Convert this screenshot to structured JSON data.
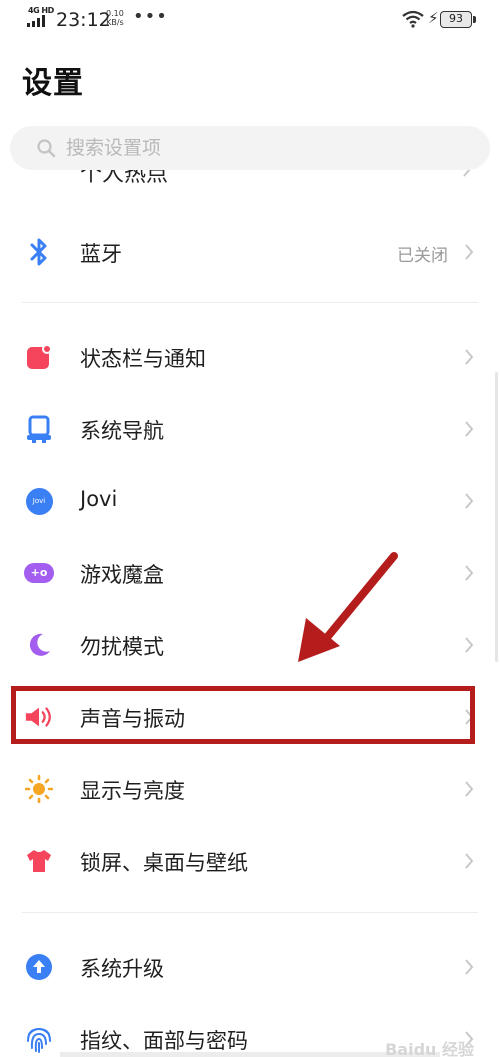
{
  "status_bar": {
    "network": "4G HD",
    "time": "23:12",
    "speed_value": "0.10",
    "speed_unit": "KB/s",
    "more": "•••",
    "battery": "93"
  },
  "page": {
    "title": "设置"
  },
  "search": {
    "placeholder": "搜索设置项"
  },
  "partial_item": {
    "label": "个人热点"
  },
  "items": [
    {
      "id": "bluetooth",
      "label": "蓝牙",
      "value": "已关闭",
      "icon": "bluetooth-icon",
      "color": "#3b7ff5"
    },
    {
      "id": "status-bar",
      "label": "状态栏与通知",
      "icon": "notification-icon",
      "color": "#f5455c"
    },
    {
      "id": "navigation",
      "label": "系统导航",
      "icon": "navigation-icon",
      "color": "#3b7ff5"
    },
    {
      "id": "jovi",
      "label": "Jovi",
      "icon": "jovi-icon",
      "icon_text": "Jovi",
      "color": "#3b7ff5"
    },
    {
      "id": "game-box",
      "label": "游戏魔盒",
      "icon": "gamepad-icon",
      "icon_text": "+o",
      "color": "#a35ef0"
    },
    {
      "id": "dnd",
      "label": "勿扰模式",
      "icon": "moon-icon",
      "color": "#a35ef0"
    },
    {
      "id": "sound",
      "label": "声音与振动",
      "icon": "speaker-icon",
      "color": "#f5455c"
    },
    {
      "id": "display",
      "label": "显示与亮度",
      "icon": "sun-icon",
      "color": "#f5a623"
    },
    {
      "id": "lockscreen",
      "label": "锁屏、桌面与壁纸",
      "icon": "shirt-icon",
      "color": "#f5455c"
    },
    {
      "id": "update",
      "label": "系统升级",
      "icon": "upgrade-icon",
      "color": "#3b7ff5"
    },
    {
      "id": "fingerprint",
      "label": "指纹、面部与密码",
      "icon": "fingerprint-icon",
      "color": "#3b7ff5"
    }
  ],
  "annotation": {
    "color": "#b51d1d",
    "target": "sound"
  },
  "watermark": "Baidu 经验"
}
